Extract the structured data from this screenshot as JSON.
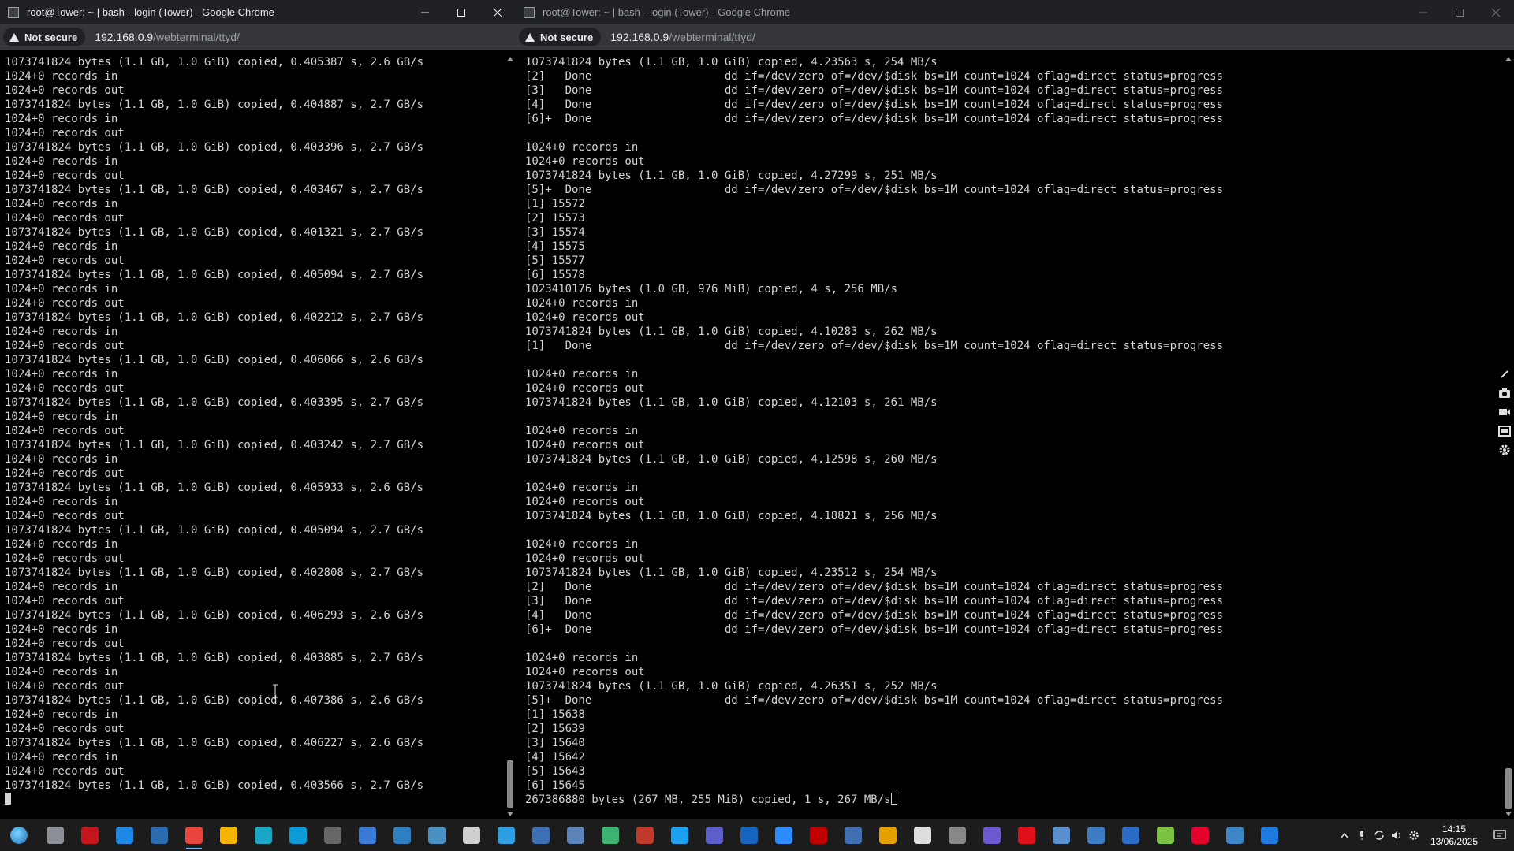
{
  "windows": [
    {
      "title": "root@Tower: ~ | bash --login (Tower) - Google Chrome",
      "security_label": "Not secure",
      "url_host": "192.168.0.9",
      "url_path": "/webterminal/ttyd/",
      "lines": [
        "1073741824 bytes (1.1 GB, 1.0 GiB) copied, 0.405387 s, 2.6 GB/s",
        "1024+0 records in",
        "1024+0 records out",
        "1073741824 bytes (1.1 GB, 1.0 GiB) copied, 0.404887 s, 2.7 GB/s",
        "1024+0 records in",
        "1024+0 records out",
        "1073741824 bytes (1.1 GB, 1.0 GiB) copied, 0.403396 s, 2.7 GB/s",
        "1024+0 records in",
        "1024+0 records out",
        "1073741824 bytes (1.1 GB, 1.0 GiB) copied, 0.403467 s, 2.7 GB/s",
        "1024+0 records in",
        "1024+0 records out",
        "1073741824 bytes (1.1 GB, 1.0 GiB) copied, 0.401321 s, 2.7 GB/s",
        "1024+0 records in",
        "1024+0 records out",
        "1073741824 bytes (1.1 GB, 1.0 GiB) copied, 0.405094 s, 2.7 GB/s",
        "1024+0 records in",
        "1024+0 records out",
        "1073741824 bytes (1.1 GB, 1.0 GiB) copied, 0.402212 s, 2.7 GB/s",
        "1024+0 records in",
        "1024+0 records out",
        "1073741824 bytes (1.1 GB, 1.0 GiB) copied, 0.406066 s, 2.6 GB/s",
        "1024+0 records in",
        "1024+0 records out",
        "1073741824 bytes (1.1 GB, 1.0 GiB) copied, 0.403395 s, 2.7 GB/s",
        "1024+0 records in",
        "1024+0 records out",
        "1073741824 bytes (1.1 GB, 1.0 GiB) copied, 0.403242 s, 2.7 GB/s",
        "1024+0 records in",
        "1024+0 records out",
        "1073741824 bytes (1.1 GB, 1.0 GiB) copied, 0.405933 s, 2.6 GB/s",
        "1024+0 records in",
        "1024+0 records out",
        "1073741824 bytes (1.1 GB, 1.0 GiB) copied, 0.405094 s, 2.7 GB/s",
        "1024+0 records in",
        "1024+0 records out",
        "1073741824 bytes (1.1 GB, 1.0 GiB) copied, 0.402808 s, 2.7 GB/s",
        "1024+0 records in",
        "1024+0 records out",
        "1073741824 bytes (1.1 GB, 1.0 GiB) copied, 0.406293 s, 2.6 GB/s",
        "1024+0 records in",
        "1024+0 records out",
        "1073741824 bytes (1.1 GB, 1.0 GiB) copied, 0.403885 s, 2.7 GB/s",
        "1024+0 records in",
        "1024+0 records out",
        "1073741824 bytes (1.1 GB, 1.0 GiB) copied, 0.407386 s, 2.6 GB/s",
        "1024+0 records in",
        "1024+0 records out",
        "1073741824 bytes (1.1 GB, 1.0 GiB) copied, 0.406227 s, 2.6 GB/s",
        "1024+0 records in",
        "1024+0 records out",
        "1073741824 bytes (1.1 GB, 1.0 GiB) copied, 0.403566 s, 2.7 GB/s",
        ""
      ],
      "cursor_style": "filled"
    },
    {
      "title": "root@Tower: ~ | bash --login (Tower) - Google Chrome",
      "security_label": "Not secure",
      "url_host": "192.168.0.9",
      "url_path": "/webterminal/ttyd/",
      "lines": [
        "1073741824 bytes (1.1 GB, 1.0 GiB) copied, 4.23563 s, 254 MB/s",
        "[2]   Done                    dd if=/dev/zero of=/dev/$disk bs=1M count=1024 oflag=direct status=progress",
        "[3]   Done                    dd if=/dev/zero of=/dev/$disk bs=1M count=1024 oflag=direct status=progress",
        "[4]   Done                    dd if=/dev/zero of=/dev/$disk bs=1M count=1024 oflag=direct status=progress",
        "[6]+  Done                    dd if=/dev/zero of=/dev/$disk bs=1M count=1024 oflag=direct status=progress",
        "",
        "1024+0 records in",
        "1024+0 records out",
        "1073741824 bytes (1.1 GB, 1.0 GiB) copied, 4.27299 s, 251 MB/s",
        "[5]+  Done                    dd if=/dev/zero of=/dev/$disk bs=1M count=1024 oflag=direct status=progress",
        "[1] 15572",
        "[2] 15573",
        "[3] 15574",
        "[4] 15575",
        "[5] 15577",
        "[6] 15578",
        "1023410176 bytes (1.0 GB, 976 MiB) copied, 4 s, 256 MB/s",
        "1024+0 records in",
        "1024+0 records out",
        "1073741824 bytes (1.1 GB, 1.0 GiB) copied, 4.10283 s, 262 MB/s",
        "[1]   Done                    dd if=/dev/zero of=/dev/$disk bs=1M count=1024 oflag=direct status=progress",
        "",
        "1024+0 records in",
        "1024+0 records out",
        "1073741824 bytes (1.1 GB, 1.0 GiB) copied, 4.12103 s, 261 MB/s",
        "",
        "1024+0 records in",
        "1024+0 records out",
        "1073741824 bytes (1.1 GB, 1.0 GiB) copied, 4.12598 s, 260 MB/s",
        "",
        "1024+0 records in",
        "1024+0 records out",
        "1073741824 bytes (1.1 GB, 1.0 GiB) copied, 4.18821 s, 256 MB/s",
        "",
        "1024+0 records in",
        "1024+0 records out",
        "1073741824 bytes (1.1 GB, 1.0 GiB) copied, 4.23512 s, 254 MB/s",
        "[2]   Done                    dd if=/dev/zero of=/dev/$disk bs=1M count=1024 oflag=direct status=progress",
        "[3]   Done                    dd if=/dev/zero of=/dev/$disk bs=1M count=1024 oflag=direct status=progress",
        "[4]   Done                    dd if=/dev/zero of=/dev/$disk bs=1M count=1024 oflag=direct status=progress",
        "[6]+  Done                    dd if=/dev/zero of=/dev/$disk bs=1M count=1024 oflag=direct status=progress",
        "",
        "1024+0 records in",
        "1024+0 records out",
        "1073741824 bytes (1.1 GB, 1.0 GiB) copied, 4.26351 s, 252 MB/s",
        "[5]+  Done                    dd if=/dev/zero of=/dev/$disk bs=1M count=1024 oflag=direct status=progress",
        "[1] 15638",
        "[2] 15639",
        "[3] 15640",
        "[4] 15642",
        "[5] 15643",
        "[6] 15645",
        "267386880 bytes (267 MB, 255 MiB) copied, 1 s, 267 MB/s"
      ],
      "cursor_style": "hollow"
    }
  ],
  "taskbar": {
    "apps": [
      {
        "name": "start-button",
        "color": "#2a7fd4"
      },
      {
        "name": "app-settings-gear",
        "color": "#8a8f98"
      },
      {
        "name": "app-red-shield",
        "color": "#c4161c"
      },
      {
        "name": "app-blue-globe",
        "color": "#1e88e5"
      },
      {
        "name": "app-blue-window",
        "color": "#2b6cb0"
      },
      {
        "name": "app-chrome",
        "color": "#e8453c"
      },
      {
        "name": "app-file-explorer",
        "color": "#f4b400"
      },
      {
        "name": "app-search-magnifier",
        "color": "#19a7c6"
      },
      {
        "name": "app-search-blue",
        "color": "#0d9bd8"
      },
      {
        "name": "app-calculator-grid",
        "color": "#666666"
      },
      {
        "name": "app-store",
        "color": "#3a7bd5"
      },
      {
        "name": "app-window-switch",
        "color": "#2f80c0"
      },
      {
        "name": "app-network-tools",
        "color": "#4a90c2"
      },
      {
        "name": "app-speedometer",
        "color": "#cfcfcf"
      },
      {
        "name": "app-vscode",
        "color": "#2f9fe3"
      },
      {
        "name": "app-image-blue",
        "color": "#3d6fb4"
      },
      {
        "name": "app-tools",
        "color": "#5d84b9"
      },
      {
        "name": "app-green-box",
        "color": "#3cb371"
      },
      {
        "name": "app-red-calendar",
        "color": "#c0392b"
      },
      {
        "name": "app-edge",
        "color": "#1ea1f1"
      },
      {
        "name": "app-teams",
        "color": "#5b5fc7"
      },
      {
        "name": "app-u-blue",
        "color": "#1565c0"
      },
      {
        "name": "app-zoom",
        "color": "#2d8cff"
      },
      {
        "name": "app-red-dot",
        "color": "#c00000"
      },
      {
        "name": "app-monitor",
        "color": "#3f6fb0"
      },
      {
        "name": "app-terminal-arrow",
        "color": "#e5a000"
      },
      {
        "name": "app-clock",
        "color": "#dddddd"
      },
      {
        "name": "app-server",
        "color": "#888888"
      },
      {
        "name": "app-cd",
        "color": "#6a5acd"
      },
      {
        "name": "app-opera",
        "color": "#e0101a"
      },
      {
        "name": "app-mail-image",
        "color": "#5a8fd0"
      },
      {
        "name": "app-calculator",
        "color": "#3c7dc4"
      },
      {
        "name": "app-grid-blue",
        "color": "#2c6cc4"
      },
      {
        "name": "app-cube-green",
        "color": "#7cc242"
      },
      {
        "name": "app-red-s",
        "color": "#e4002b"
      },
      {
        "name": "app-monitor-2",
        "color": "#3d85c6"
      },
      {
        "name": "app-chart-blue",
        "color": "#1f7ae0"
      }
    ],
    "time": "14:15",
    "date": "13/06/2025"
  }
}
